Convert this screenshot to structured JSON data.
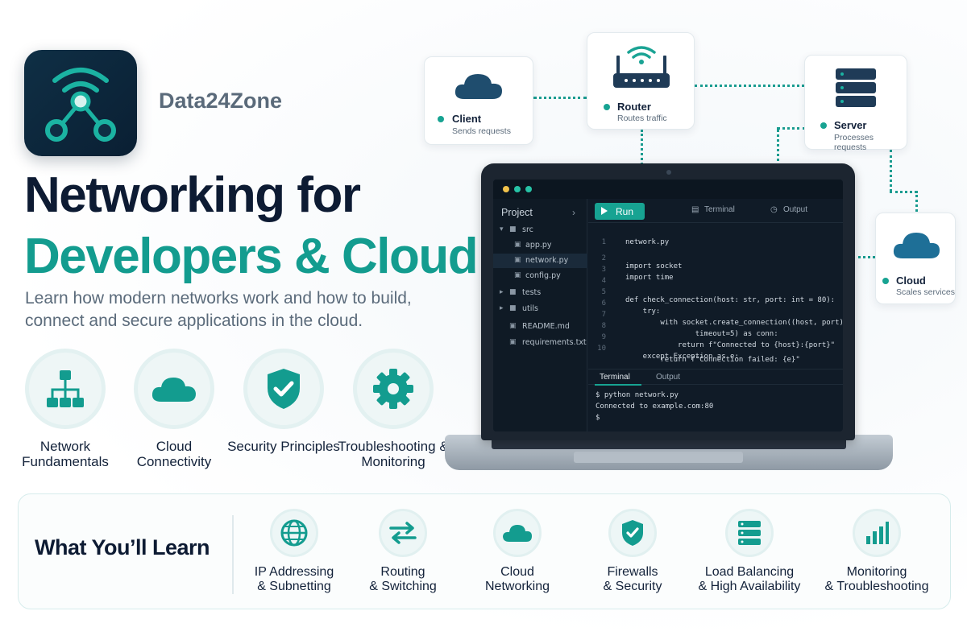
{
  "brand": {
    "name": "Data24Zone",
    "logo_icon": "network-node-icon"
  },
  "headline": {
    "line1": "Networking for",
    "line2": "Developers & Cloud"
  },
  "subtitle": "Learn how modern networks work and how to build, connect and secure applications in the cloud.",
  "features": [
    {
      "label": "Network Fundamentals",
      "icon": "hierarchy-icon"
    },
    {
      "label": "Cloud Connectivity",
      "icon": "cloud-icon"
    },
    {
      "label": "Security Principles",
      "icon": "shield-check-icon"
    },
    {
      "label": "Troubleshooting & Monitoring",
      "icon": "gear-icon"
    }
  ],
  "diagram": {
    "client": {
      "title": "Client",
      "subtitle": "Sends requests",
      "icon": "cloud-icon"
    },
    "router": {
      "title": "Router",
      "subtitle": "Routes traffic",
      "icon": "router-icon"
    },
    "server": {
      "title": "Server",
      "subtitle": "Processes requests",
      "icon": "server-icon"
    },
    "cloud": {
      "title": "Cloud",
      "subtitle": "Scales services",
      "icon": "cloud-icon"
    }
  },
  "ide": {
    "sidebar_title": "Project",
    "files": [
      {
        "name": "src",
        "type": "folder-open"
      },
      {
        "name": "app.py",
        "type": "file"
      },
      {
        "name": "network.py",
        "type": "file",
        "selected": true
      },
      {
        "name": "config.py",
        "type": "file"
      },
      {
        "name": "tests",
        "type": "folder"
      },
      {
        "name": "utils",
        "type": "folder"
      },
      {
        "name": "README.md",
        "type": "file"
      },
      {
        "name": "requirements.txt",
        "type": "file"
      }
    ],
    "run_label": "Run",
    "terminal_label": "Terminal",
    "output_label": "Output",
    "filename": "network.py",
    "code_lines": [
      "import socket",
      "import time",
      "",
      "def check_connection(host: str, port: int = 80):",
      "    try:",
      "        with socket.create_connection((host, port),",
      "                timeout=5) as conn:",
      "            return f\"Connected to {host}:{port}\"",
      "    except Exception as e:",
      "        return f\"Connection failed: {e}\""
    ],
    "line_numbers": [
      "1",
      "2",
      "3",
      "4",
      "5",
      "6",
      "7",
      "8",
      "9",
      "10"
    ],
    "term_tabs": [
      "Terminal",
      "Output"
    ],
    "terminal_lines": [
      "$ python network.py",
      "Connected to example.com:80",
      "$"
    ]
  },
  "learn": {
    "title": "What You’ll Learn",
    "items": [
      {
        "line1": "IP Addressing",
        "line2": "& Subnetting",
        "icon": "globe-icon"
      },
      {
        "line1": "Routing",
        "line2": "& Switching",
        "icon": "arrows-exchange-icon"
      },
      {
        "line1": "Cloud",
        "line2": "Networking",
        "icon": "cloud-icon"
      },
      {
        "line1": "Firewalls",
        "line2": "& Security",
        "icon": "shield-check-icon"
      },
      {
        "line1": "Load Balancing",
        "line2": "& High Availability",
        "icon": "server-icon"
      },
      {
        "line1": "Monitoring",
        "line2": "& Troubleshooting",
        "icon": "bar-chart-icon"
      }
    ]
  },
  "colors": {
    "accent": "#139c8f",
    "navy": "#0d1b33",
    "text_muted": "#5b6b7b"
  }
}
